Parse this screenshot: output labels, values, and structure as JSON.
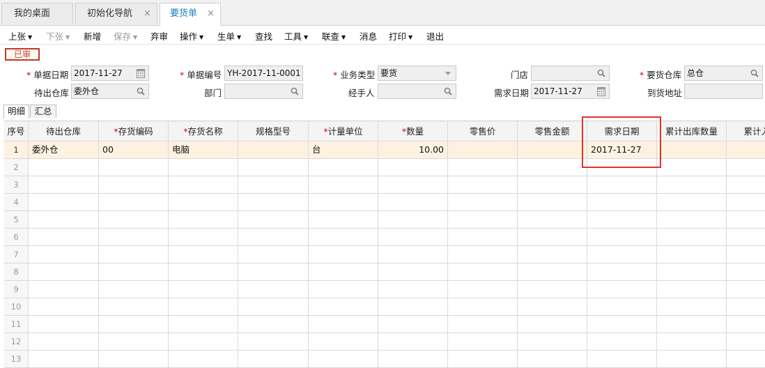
{
  "tabs": [
    {
      "label": "我的桌面",
      "closable": false,
      "active": false
    },
    {
      "label": "初始化导航",
      "closable": true,
      "active": false
    },
    {
      "label": "要货单",
      "closable": true,
      "active": true
    }
  ],
  "close_glyph": "×",
  "toolbar": [
    {
      "label": "上张",
      "dropdown": true,
      "disabled": false
    },
    {
      "label": "下张",
      "dropdown": true,
      "disabled": true
    },
    {
      "label": "新增",
      "dropdown": false,
      "disabled": false
    },
    {
      "label": "保存",
      "dropdown": true,
      "disabled": true
    },
    {
      "label": "弃审",
      "dropdown": false,
      "disabled": false
    },
    {
      "label": "操作",
      "dropdown": true,
      "disabled": false
    },
    {
      "label": "生单",
      "dropdown": true,
      "disabled": false
    },
    {
      "label": "查找",
      "dropdown": false,
      "disabled": false
    },
    {
      "label": "工具",
      "dropdown": true,
      "disabled": false
    },
    {
      "label": "联查",
      "dropdown": true,
      "disabled": false
    },
    {
      "label": "消息",
      "dropdown": false,
      "disabled": false
    },
    {
      "label": "打印",
      "dropdown": true,
      "disabled": false
    },
    {
      "label": "退出",
      "dropdown": false,
      "disabled": false
    }
  ],
  "status_stamp": "已审",
  "form": {
    "doc_date": {
      "label": "单据日期",
      "required": true,
      "value": "2017-11-27",
      "icon": "calendar-icon"
    },
    "doc_no": {
      "label": "单据编号",
      "required": true,
      "value": "YH-2017-11-0001"
    },
    "biz_type": {
      "label": "业务类型",
      "required": true,
      "value": "要货",
      "icon": "dropdown-arrow-icon"
    },
    "store": {
      "label": "门店",
      "required": false,
      "value": "",
      "icon": "search-icon"
    },
    "req_warehouse": {
      "label": "要货仓库",
      "required": true,
      "value": "总仓",
      "icon": "search-icon"
    },
    "out_warehouse": {
      "label": "待出仓库",
      "required": false,
      "value": "委外仓",
      "icon": "search-icon"
    },
    "department": {
      "label": "部门",
      "required": false,
      "value": "",
      "icon": "search-icon"
    },
    "handler": {
      "label": "经手人",
      "required": false,
      "value": "",
      "icon": "search-icon"
    },
    "demand_date": {
      "label": "需求日期",
      "required": false,
      "value": "2017-11-27",
      "icon": "calendar-icon"
    },
    "arrival_address": {
      "label": "到货地址",
      "required": false,
      "value": ""
    }
  },
  "subtabs": [
    {
      "label": "明细",
      "active": true
    },
    {
      "label": "汇总",
      "active": false
    }
  ],
  "table": {
    "columns": [
      {
        "label": "序号",
        "required": false
      },
      {
        "label": "待出仓库",
        "required": false
      },
      {
        "label": "存货编码",
        "required": true
      },
      {
        "label": "存货名称",
        "required": true
      },
      {
        "label": "规格型号",
        "required": false
      },
      {
        "label": "计量单位",
        "required": true
      },
      {
        "label": "数量",
        "required": true
      },
      {
        "label": "零售价",
        "required": false
      },
      {
        "label": "零售金额",
        "required": false
      },
      {
        "label": "需求日期",
        "required": false
      },
      {
        "label": "累计出库数量",
        "required": false
      },
      {
        "label": "累计入库",
        "required": false
      }
    ],
    "rows": [
      [
        "1",
        "委外仓",
        "00",
        "电脑",
        "",
        "台",
        "10.00",
        "",
        "",
        "2017-11-27",
        "",
        ""
      ],
      [
        "2",
        "",
        "",
        "",
        "",
        "",
        "",
        "",
        "",
        "",
        "",
        ""
      ],
      [
        "3",
        "",
        "",
        "",
        "",
        "",
        "",
        "",
        "",
        "",
        "",
        ""
      ],
      [
        "4",
        "",
        "",
        "",
        "",
        "",
        "",
        "",
        "",
        "",
        "",
        ""
      ],
      [
        "5",
        "",
        "",
        "",
        "",
        "",
        "",
        "",
        "",
        "",
        "",
        ""
      ],
      [
        "6",
        "",
        "",
        "",
        "",
        "",
        "",
        "",
        "",
        "",
        "",
        ""
      ],
      [
        "7",
        "",
        "",
        "",
        "",
        "",
        "",
        "",
        "",
        "",
        "",
        ""
      ],
      [
        "8",
        "",
        "",
        "",
        "",
        "",
        "",
        "",
        "",
        "",
        "",
        ""
      ],
      [
        "9",
        "",
        "",
        "",
        "",
        "",
        "",
        "",
        "",
        "",
        "",
        ""
      ],
      [
        "10",
        "",
        "",
        "",
        "",
        "",
        "",
        "",
        "",
        "",
        "",
        ""
      ],
      [
        "11",
        "",
        "",
        "",
        "",
        "",
        "",
        "",
        "",
        "",
        "",
        ""
      ],
      [
        "12",
        "",
        "",
        "",
        "",
        "",
        "",
        "",
        "",
        "",
        "",
        ""
      ],
      [
        "13",
        "",
        "",
        "",
        "",
        "",
        "",
        "",
        "",
        "",
        "",
        ""
      ]
    ]
  },
  "colors": {
    "accent_tab": "#1a7fc3",
    "required": "#d0021b",
    "stamp": "#c0392b",
    "selected_row": "#fdf2e1",
    "highlight_box": "#e4312c"
  }
}
